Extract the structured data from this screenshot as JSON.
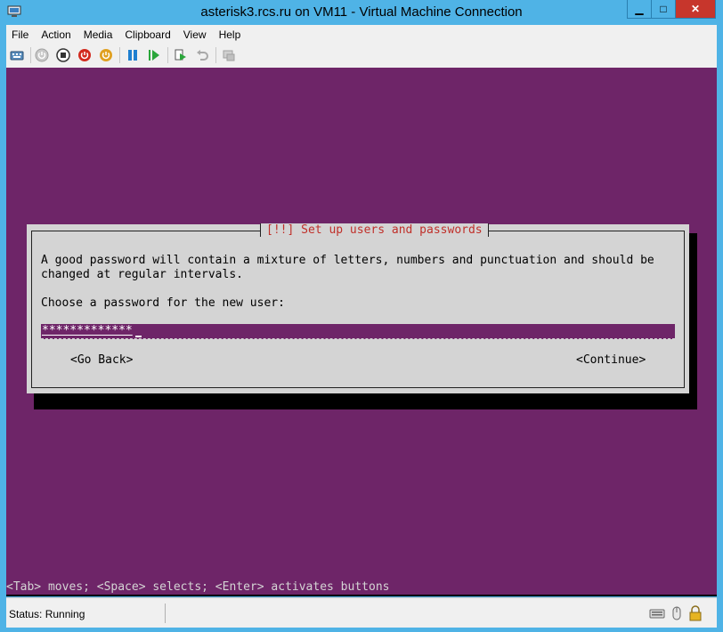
{
  "window": {
    "title": "asterisk3.rcs.ru on VM11 - Virtual Machine Connection",
    "minimize_glyph": "▁",
    "maximize_glyph": "□",
    "close_glyph": "✕"
  },
  "menu": {
    "items": [
      "File",
      "Action",
      "Media",
      "Clipboard",
      "View",
      "Help"
    ]
  },
  "toolbar": {
    "buttons": [
      "ctrl-alt-del",
      "start",
      "turn-off",
      "shutdown",
      "save",
      "pause",
      "resume",
      "checkpoint",
      "revert",
      "enhanced-session"
    ]
  },
  "vm": {
    "bg_color": "#6e2568",
    "dialog": {
      "title": "[!!] Set up users and passwords",
      "line1": "A good password will contain a mixture of letters, numbers and punctuation and should be",
      "line2": "changed at regular intervals.",
      "prompt": "Choose a password for the new user:",
      "password_value": "*************",
      "back_label": "<Go Back>",
      "continue_label": "<Continue>"
    },
    "hint": "<Tab> moves; <Space> selects; <Enter> activates buttons"
  },
  "status": {
    "text": "Status: Running"
  }
}
